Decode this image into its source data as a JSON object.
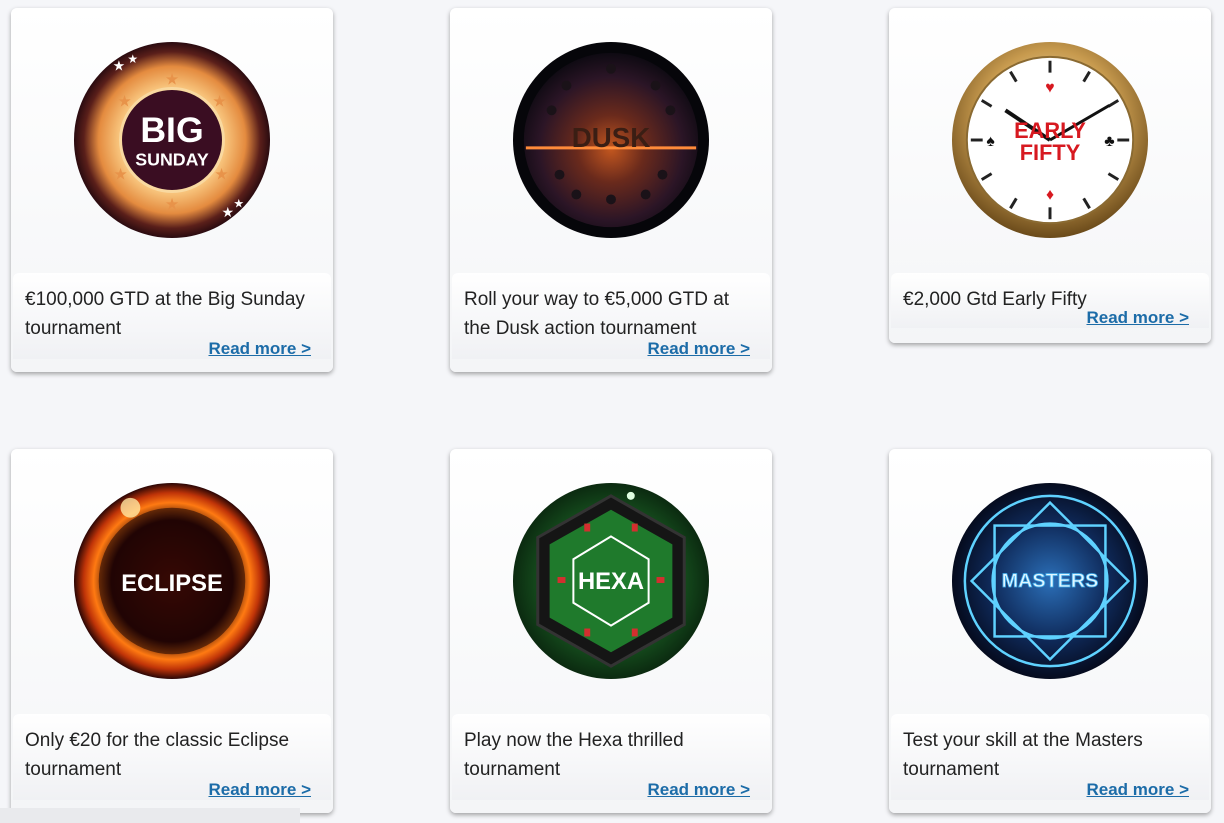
{
  "cards": [
    {
      "logo_icon": "big-sunday-logo",
      "logo_text": [
        "BIG",
        "SUNDAY"
      ],
      "description": "€100,000 GTD at the Big Sunday tournament",
      "link": "Read more >"
    },
    {
      "logo_icon": "dusk-logo",
      "logo_text": [
        "DUSK"
      ],
      "description": "Roll your way to €5,000 GTD at the Dusk action tournament",
      "link": "Read more >"
    },
    {
      "logo_icon": "early-fifty-clock-logo",
      "logo_text": [
        "EARLY",
        "FIFTY"
      ],
      "description": "€2,000 Gtd Early Fifty",
      "link": "Read more >"
    },
    {
      "logo_icon": "eclipse-logo",
      "logo_text": [
        "ECLIPSE"
      ],
      "description": "Only €20 for the classic Eclipse tournament",
      "link": "Read more >"
    },
    {
      "logo_icon": "hexa-logo",
      "logo_text": [
        "HEXA"
      ],
      "description": "Play now the Hexa thrilled tournament",
      "link": "Read more >"
    },
    {
      "logo_icon": "masters-logo",
      "logo_text": [
        "MASTERS"
      ],
      "description": "Test your skill at the Masters tournament",
      "link": "Read more >"
    }
  ]
}
